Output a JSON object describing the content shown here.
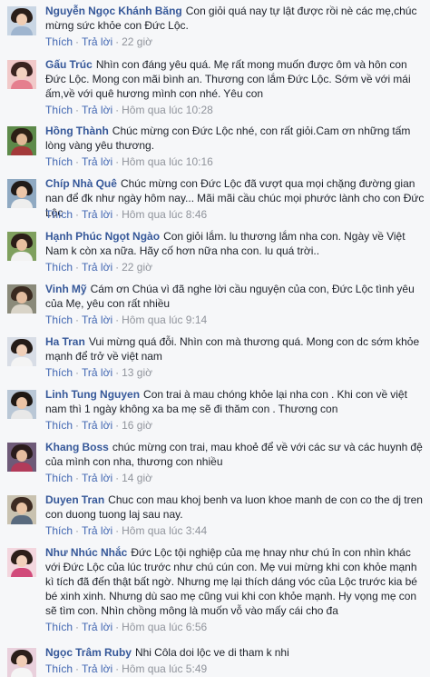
{
  "comments": [
    {
      "author": "Nguyễn Ngọc Khánh Băng",
      "text": "Con giỏi quá nay tự lật được rồi nè các mẹ,chúc mừng sức khỏe con Đức Lộc.",
      "like": "Thích",
      "reply": "Trả lời",
      "time": "22 giờ",
      "avatar_colors": [
        "#c9d6e4",
        "#2a1f1a",
        "#f0cdb3",
        "#9fb5cf"
      ]
    },
    {
      "author": "Gấu Trúc",
      "text": "Nhìn con đáng yêu quá. Mẹ rất mong muốn được ôm và hôn con Đức Lộc. Mong con mãi bình an. Thương con lắm Đức Lộc. Sớm về với mái ấm,về với quê hương mình con nhé. Yêu con",
      "like": "Thích",
      "reply": "Trả lời",
      "time": "Hôm qua lúc 10:28",
      "avatar_colors": [
        "#f1c9c9",
        "#3a2420",
        "#f3d2c0",
        "#e57f8e"
      ]
    },
    {
      "author": "Hồng Thành",
      "text": "Chúc mừng con Đức Lộc nhé, con rất giỏi.Cam ơn những tấm lòng vàng yêu thương.",
      "like": "Thích",
      "reply": "Trả lời",
      "time": "Hôm qua lúc 10:16",
      "avatar_colors": [
        "#5d8a4a",
        "#2c2016",
        "#e0b896",
        "#a33a3a"
      ]
    },
    {
      "author": "Chíp Nhà Quê",
      "text": "Chúc mừng con Đức Lộc đã vượt qua mọi chặng đường gian nan để đk như ngày hôm nay... Mãi mãi cầu chúc mọi phước lành cho con Đức Lộc",
      "like": "Thích",
      "reply": "Trả lời",
      "time": "Hôm qua lúc 8:46",
      "avatar_colors": [
        "#8fa9c2",
        "#1f1a18",
        "#ecc6a8",
        "#eeeeee"
      ]
    },
    {
      "author": "Hạnh Phúc Ngọt Ngào",
      "text": "Con giỏi lắm. lu thương lắm nha con. Ngày về Việt Nam k còn xa nữa. Hãy cố hơn nữa nha con. lu quá trời..",
      "like": "Thích",
      "reply": "Trả lời",
      "time": "22 giờ",
      "avatar_colors": [
        "#7fa05e",
        "#2b1e18",
        "#e8c0a0",
        "#f2f2f2"
      ]
    },
    {
      "author": "Vinh Mỹ",
      "text": "Cám ơn Chúa vì đã nghe lời cầu nguyện của con, Đức Lộc tình yêu của Mẹ, yêu con rất nhiều",
      "like": "Thích",
      "reply": "Trả lời",
      "time": "Hôm qua lúc 9:14",
      "avatar_colors": [
        "#8a8a7a",
        "#3a2a20",
        "#e4bea0",
        "#d9d4c8"
      ]
    },
    {
      "author": "Ha Tran",
      "text": "Vui mừng quá đỗi. Nhìn con mà thương quá. Mong con dc sớm khỏe mạnh để trở về việt nam",
      "like": "Thích",
      "reply": "Trả lời",
      "time": "13 giờ",
      "avatar_colors": [
        "#d8dde6",
        "#251c18",
        "#f0cfb8",
        "#f4f4f4"
      ]
    },
    {
      "author": "Linh Tung Nguyen",
      "text": "Con trai à mau chóng khỏe lại nha con . Khi con về việt nam thì 1 ngày không xa ba mẹ sẽ đi thăm con . Thương con",
      "like": "Thích",
      "reply": "Trả lời",
      "time": "16 giờ",
      "avatar_colors": [
        "#b9c7d6",
        "#1e1814",
        "#ebc4a6",
        "#e8e8e8"
      ]
    },
    {
      "author": "Khang Boss",
      "text": "chúc mừng con trai, mau khoẻ để về với các sư và các huynh đệ của mình con nha, thương con nhiều",
      "like": "Thích",
      "reply": "Trả lời",
      "time": "14 giờ",
      "avatar_colors": [
        "#6e5a78",
        "#2a1c1c",
        "#e6bda0",
        "#b23b5a"
      ]
    },
    {
      "author": "Duyen Tran",
      "text": "Chuc con mau khoj benh va luon khoe manh de con co the dj tren con duong tuong laj sau nay.",
      "like": "Thích",
      "reply": "Trả lời",
      "time": "Hôm qua lúc 3:44",
      "avatar_colors": [
        "#c9c2b0",
        "#3d2b22",
        "#eac4a5",
        "#596a7e"
      ]
    },
    {
      "author": "Như Nhúc Nhắc",
      "text": "Đức Lộc tội nghiệp của mẹ hnay như chú ỉn con nhìn khác với Đức Lộc của lúc trước như chú cún con. Mẹ vui mừng khi con khỏe mạnh kì tích đã đến thật bất ngờ. Nhưng mẹ lại thích dáng vóc của Lộc trước kia bé bé xinh xinh. Nhưng dù sao mẹ cũng vui khi con khỏe mạnh. Hy vọng mẹ con sẽ tìm con. Nhìn chồng mông là muốn vỗ vào mấy cái cho đa",
      "like": "Thích",
      "reply": "Trả lời",
      "time": "Hôm qua lúc 6:56",
      "avatar_colors": [
        "#f3d6de",
        "#2d1f1a",
        "#f2d0bb",
        "#d14a7a"
      ]
    },
    {
      "author": "Ngọc Trâm Ruby",
      "text": "Nhi Côla doi lộc ve di tham k nhi",
      "like": "Thích",
      "reply": "Trả lời",
      "time": "Hôm qua lúc 5:49",
      "avatar_colors": [
        "#e9d0dc",
        "#2a1e1a",
        "#f0ccb5",
        "#f5f5f5"
      ]
    }
  ]
}
